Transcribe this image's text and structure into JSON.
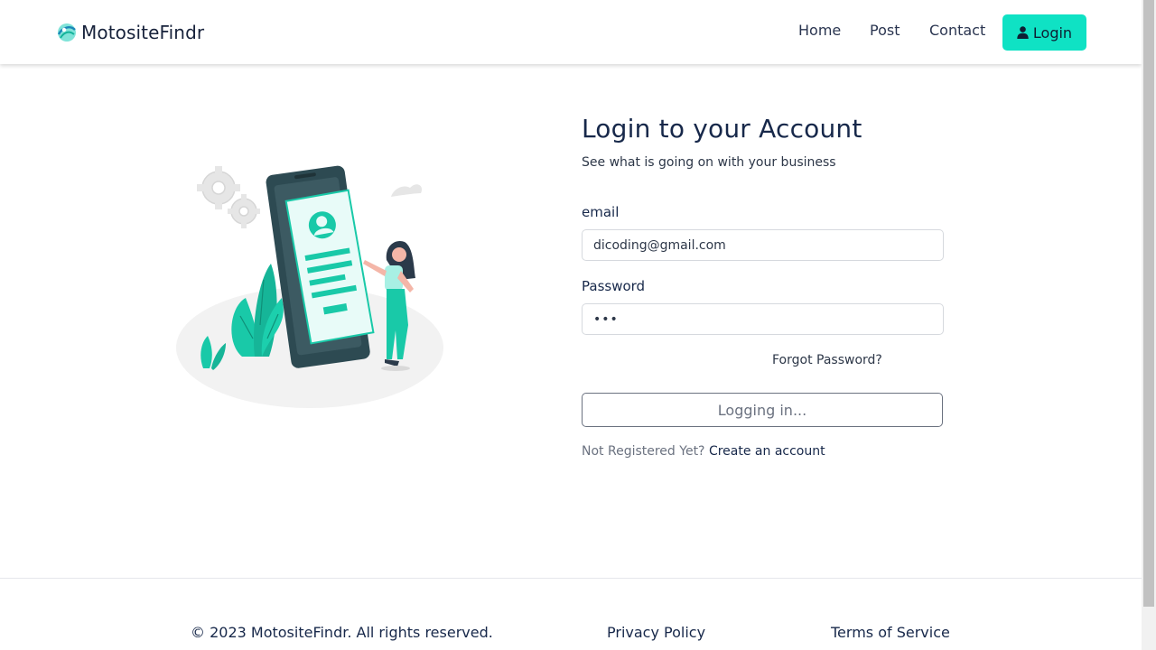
{
  "brand": {
    "name": "MotositeFindr"
  },
  "nav": {
    "home": "Home",
    "post": "Post",
    "contact": "Contact",
    "login": "Login"
  },
  "login_form": {
    "title": "Login to your Account",
    "subtitle": "See what is going on with your business",
    "email_label": "email",
    "email_value": "dicoding@gmail.com",
    "password_label": "Password",
    "password_value": "•••",
    "forgot_password": "Forgot Password?",
    "submit_label": "Logging in...",
    "register_prompt": "Not Registered Yet?",
    "register_link": "Create an account"
  },
  "footer": {
    "copyright": "© 2023 MotositeFindr. All rights reserved.",
    "privacy": "Privacy Policy",
    "terms": "Terms of Service"
  },
  "colors": {
    "accent": "#0fe2c4",
    "illustration_green": "#19c9a8",
    "text_dark": "#17284a"
  },
  "icons": {
    "brand": "globe-logo-icon",
    "login": "user-icon"
  }
}
